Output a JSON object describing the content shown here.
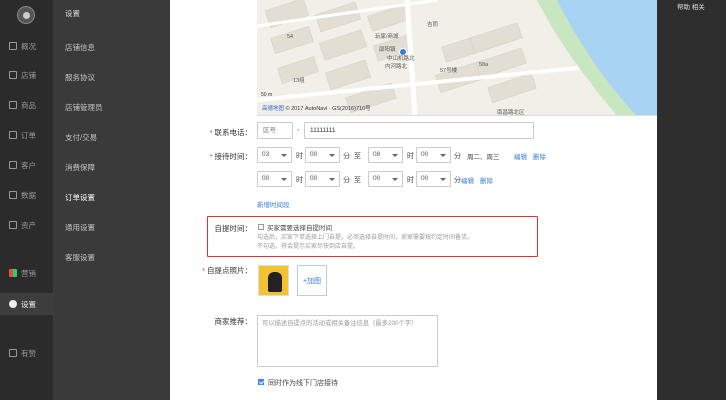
{
  "nav": {
    "items": [
      {
        "label": "概况",
        "icon": "dashboard-icon"
      },
      {
        "label": "店铺",
        "icon": "store-icon"
      },
      {
        "label": "商品",
        "icon": "tag-icon"
      },
      {
        "label": "订单",
        "icon": "order-icon"
      },
      {
        "label": "客户",
        "icon": "user-icon"
      },
      {
        "label": "数据",
        "icon": "chart-icon"
      },
      {
        "label": "资产",
        "icon": "asset-icon"
      },
      {
        "label": "营销",
        "icon": "apps-icon"
      },
      {
        "label": "设置",
        "icon": "gear-icon"
      },
      {
        "label": "有赞",
        "icon": "brand-icon"
      }
    ]
  },
  "subnav": {
    "title": "设置",
    "items": [
      "店铺信息",
      "服务协议",
      "店铺管理员",
      "支付/交易",
      "消费保障",
      "订单设置",
      "通用设置",
      "客服设置"
    ]
  },
  "topright": "帮助  相关",
  "map": {
    "labels": [
      "吉而",
      "54",
      "玩家/商城",
      "邵阳镇",
      "中山机路北",
      "内河路北",
      "13组",
      "57号楼",
      "南昌路北区",
      "58a"
    ],
    "scale": "50 m",
    "credit_link": "高德地图",
    "credit_text": "© 2017 AutoNavi · GS(2016)710号"
  },
  "phone": {
    "label": "联系电话：",
    "area_placeholder": "区号",
    "dash": "-",
    "number": "11111111"
  },
  "hours": {
    "label": "接待时间：",
    "row1": {
      "h1": "03",
      "m1": "00",
      "h2": "08",
      "m2": "00",
      "days": "周二、周三",
      "edit": "编辑",
      "del": "删除"
    },
    "row2": {
      "h1": "00",
      "m1": "00",
      "h2": "00",
      "m2": "00",
      "days": "分",
      "edit": "编辑",
      "del": "删除"
    },
    "sep_hour": "时",
    "sep_min": "分",
    "to": "至",
    "add": "新增时间段"
  },
  "pickup_time": {
    "label": "自提时间：",
    "checkbox_label": "买家需要选择自提时间",
    "help1": "勾选后，买家下单选择上门自提，必须选择自提时间，卖家需要按约定时间备货。",
    "help2": "不勾选，将会提示买家尽快到店自提。"
  },
  "photos": {
    "label": "自提点照片：",
    "add": "+加图"
  },
  "recommend": {
    "label": "商家推荐：",
    "placeholder": "可以描述自提点的活动或相关备注信息（最多200个字）"
  },
  "also_store": {
    "label": "同时作为线下门店接待"
  },
  "colors": {
    "highlight": "#d33333",
    "link": "#3a7bd5",
    "nav_bg": "#2b2b2b"
  }
}
